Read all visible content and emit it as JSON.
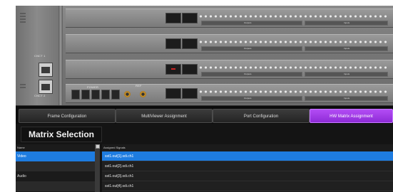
{
  "chassis": {
    "cnct1_label": "CNCT 1",
    "cnct2_label": "CNCT 2",
    "power_label": "POWER",
    "ref_label": "REF",
    "cards": [
      {
        "strip_left": "Outputs",
        "strip_right": "Inputs",
        "has_red": false
      },
      {
        "strip_left": "Outputs",
        "strip_right": "Inputs",
        "has_red": false
      },
      {
        "strip_left": "Outputs",
        "strip_right": "Inputs",
        "has_red": true
      },
      {
        "strip_left": "Outputs",
        "strip_right": "Inputs",
        "has_red": false
      }
    ]
  },
  "tabs": [
    {
      "label": "Frame Configuration",
      "active": false
    },
    {
      "label": "MultiViewer Assignment",
      "active": false
    },
    {
      "label": "Port Configuration",
      "active": false
    },
    {
      "label": "HW Matrix Assignment",
      "active": true
    }
  ],
  "matrix": {
    "title": "Matrix Selection",
    "names_header": "Name",
    "names": [
      "Video",
      "",
      "Audio",
      ""
    ],
    "signals_header": "Assigned Signals",
    "signals": [
      "sst1.out[1].sdi.ch1",
      "sst1.out[2].sdi.ch1",
      "sst1.out[3].sdi.ch1",
      "sst1.out[4].sdi.ch1"
    ]
  },
  "colors": {
    "accent_tab": "#a53ff0",
    "selection": "#1e7ce0"
  }
}
